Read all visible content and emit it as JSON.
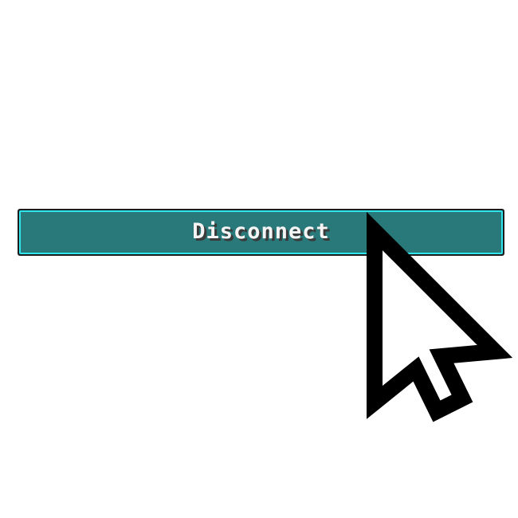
{
  "button": {
    "label": "Disconnect",
    "colors": {
      "outer_border": "#1c1c1c",
      "highlight": "#2ee6ec",
      "fill": "#29797a",
      "text": "#f4f4f4",
      "text_shadow": "#3a3a3a"
    }
  },
  "cursor": {
    "icon": "arrow-pointer-icon",
    "colors": {
      "outline": "#000000",
      "fill": "#ffffff"
    }
  }
}
